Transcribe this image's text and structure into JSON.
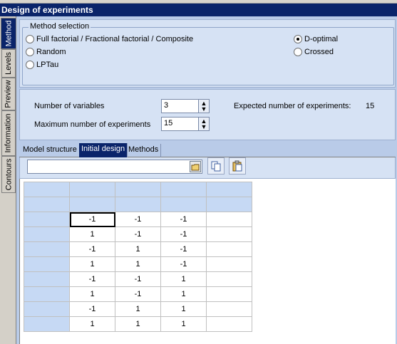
{
  "window": {
    "title": "Design of experiments"
  },
  "side_tabs": [
    "Method",
    "Levels",
    "Preview",
    "Information",
    "Contours"
  ],
  "method_selection": {
    "label": "Method selection",
    "options_left": [
      "Full factorial / Fractional factorial / Composite",
      "Random",
      "LPTau"
    ],
    "options_right": [
      "D-optimal",
      "Crossed"
    ],
    "selected": "D-optimal"
  },
  "params": {
    "num_vars_label": "Number of variables",
    "num_vars_value": "3",
    "max_exp_label": "Maximum number of experiments",
    "max_exp_value": "15",
    "expected_label": "Expected number of experiments:",
    "expected_value": "15"
  },
  "tabs": [
    "Model structure",
    "Initial design",
    "Methods"
  ],
  "active_tab": "Initial design",
  "toolbar": {
    "combo_value": "",
    "icons": [
      "open-folder-icon",
      "copy-icon",
      "paste-icon"
    ]
  },
  "grid": {
    "rows": [
      [
        "-1",
        "-1",
        "-1",
        ""
      ],
      [
        "1",
        "-1",
        "-1",
        ""
      ],
      [
        "-1",
        "1",
        "-1",
        ""
      ],
      [
        "1",
        "1",
        "-1",
        ""
      ],
      [
        "-1",
        "-1",
        "1",
        ""
      ],
      [
        "1",
        "-1",
        "1",
        ""
      ],
      [
        "-1",
        "1",
        "1",
        ""
      ],
      [
        "1",
        "1",
        "1",
        ""
      ]
    ]
  }
}
